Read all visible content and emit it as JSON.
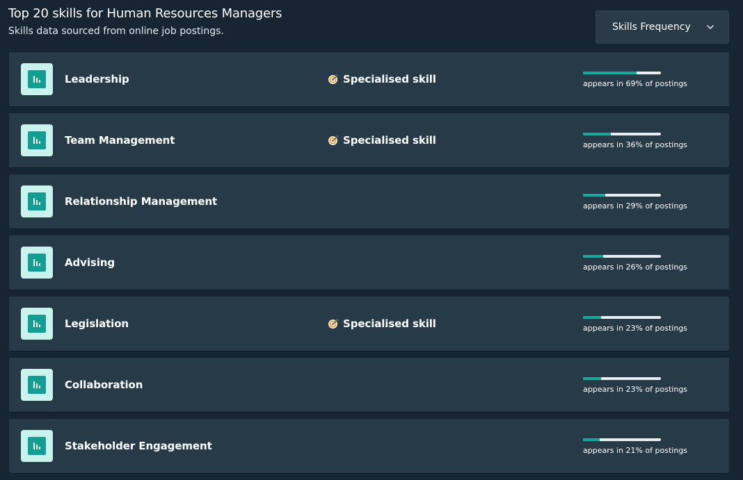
{
  "header": {
    "title": "Top 20 skills for Human Resources Managers",
    "subtitle": "Skills data sourced from online job postings."
  },
  "dropdown": {
    "selected": "Skills Frequency",
    "icon": "chevron-down-icon"
  },
  "colors": {
    "background": "#172431",
    "row": "#263a48",
    "accent": "#15a89b",
    "icon_bg": "#c9f3ec",
    "bar_track": "#e7edf0"
  },
  "skills": [
    {
      "name": "Leadership",
      "tag": "Specialised skill",
      "percent": 69,
      "frequency_text": "appears in 69% of postings"
    },
    {
      "name": "Team Management",
      "tag": "Specialised skill",
      "percent": 36,
      "frequency_text": "appears in 36% of postings"
    },
    {
      "name": "Relationship Management",
      "tag": "",
      "percent": 29,
      "frequency_text": "appears in 29% of postings"
    },
    {
      "name": "Advising",
      "tag": "",
      "percent": 26,
      "frequency_text": "appears in 26% of postings"
    },
    {
      "name": "Legislation",
      "tag": "Specialised skill",
      "percent": 23,
      "frequency_text": "appears in 23% of postings"
    },
    {
      "name": "Collaboration",
      "tag": "",
      "percent": 23,
      "frequency_text": "appears in 23% of postings"
    },
    {
      "name": "Stakeholder Engagement",
      "tag": "",
      "percent": 21,
      "frequency_text": "appears in 21% of postings"
    }
  ]
}
